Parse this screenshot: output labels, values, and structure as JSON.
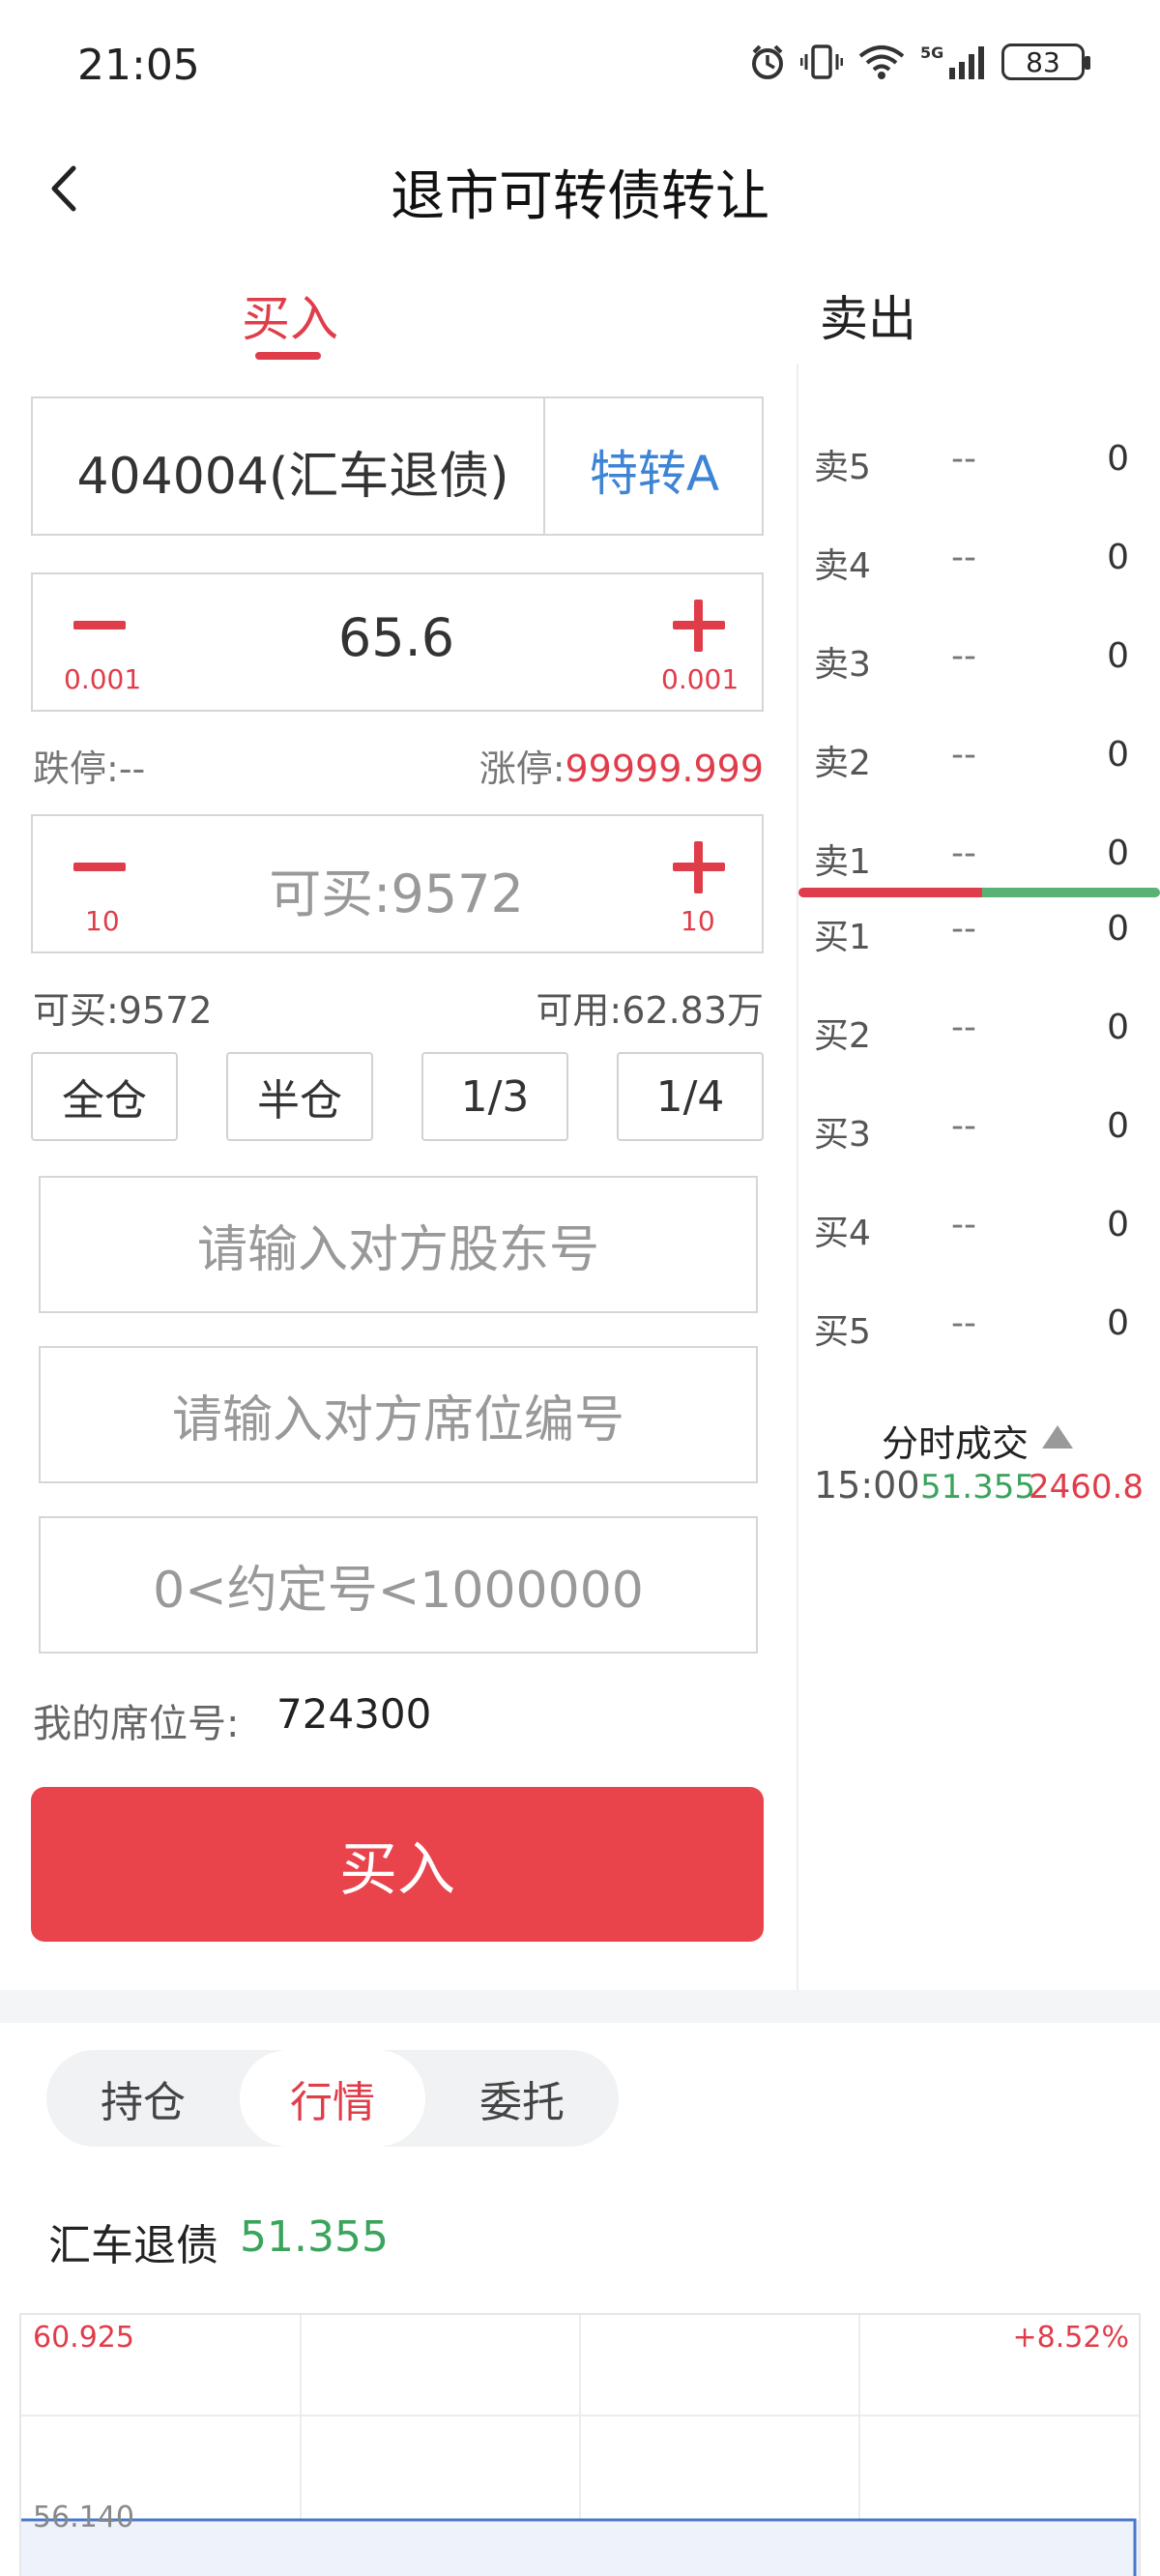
{
  "status": {
    "time": "21:05",
    "battery": "83",
    "network": "5G"
  },
  "header": {
    "title": "退市可转债转让",
    "back_icon": "chevron-left-icon"
  },
  "tabs": {
    "buy": "买入",
    "sell": "卖出",
    "active": "buy"
  },
  "security": {
    "code_name": "404004(汇车退债)",
    "tag": "特转A"
  },
  "price_stepper": {
    "value": "65.6",
    "minus_step": "0.001",
    "plus_step": "0.001"
  },
  "limits": {
    "down_label": "跌停:",
    "down_value": "--",
    "up_label": "涨停:",
    "up_value": "99999.999"
  },
  "qty_stepper": {
    "placeholder": "可买:9572",
    "minus_step": "10",
    "plus_step": "10"
  },
  "availability": {
    "can_buy": "可买:9572",
    "available": "可用:62.83万"
  },
  "position_buttons": [
    "全仓",
    "半仓",
    "1/3",
    "1/4"
  ],
  "inputs": {
    "counterparty_holder": "请输入对方股东号",
    "counterparty_seat": "请输入对方席位编号",
    "agreement_no": "0<约定号<1000000"
  },
  "seat": {
    "label": "我的席位号:",
    "value": "724300"
  },
  "submit_label": "买入",
  "order_book": {
    "asks": [
      {
        "label": "卖5",
        "price": "--",
        "volume": "0"
      },
      {
        "label": "卖4",
        "price": "--",
        "volume": "0"
      },
      {
        "label": "卖3",
        "price": "--",
        "volume": "0"
      },
      {
        "label": "卖2",
        "price": "--",
        "volume": "0"
      },
      {
        "label": "卖1",
        "price": "--",
        "volume": "0"
      }
    ],
    "bids": [
      {
        "label": "买1",
        "price": "--",
        "volume": "0"
      },
      {
        "label": "买2",
        "price": "--",
        "volume": "0"
      },
      {
        "label": "买3",
        "price": "--",
        "volume": "0"
      },
      {
        "label": "买4",
        "price": "--",
        "volume": "0"
      },
      {
        "label": "买5",
        "price": "--",
        "volume": "0"
      }
    ],
    "bar_colors": {
      "ask": "#e03d4a",
      "bid": "#57b274"
    }
  },
  "time_sales": {
    "title": "分时成交",
    "rows": [
      {
        "time": "15:00",
        "price": "51.355",
        "volume": "2460.8"
      }
    ]
  },
  "bottom_tabs": {
    "items": [
      "持仓",
      "行情",
      "委托"
    ],
    "active": "行情"
  },
  "quote": {
    "name": "汇车退债",
    "price": "51.355"
  },
  "mini_chart": {
    "top_left": "60.925",
    "top_right": "+8.52%",
    "mid_left": "56.140",
    "line_value": "56.140"
  },
  "colors": {
    "accent_red": "#e03d4a",
    "accent_green": "#3aa35c",
    "link_blue": "#3e84d6",
    "chart_line": "#4a78c8"
  }
}
